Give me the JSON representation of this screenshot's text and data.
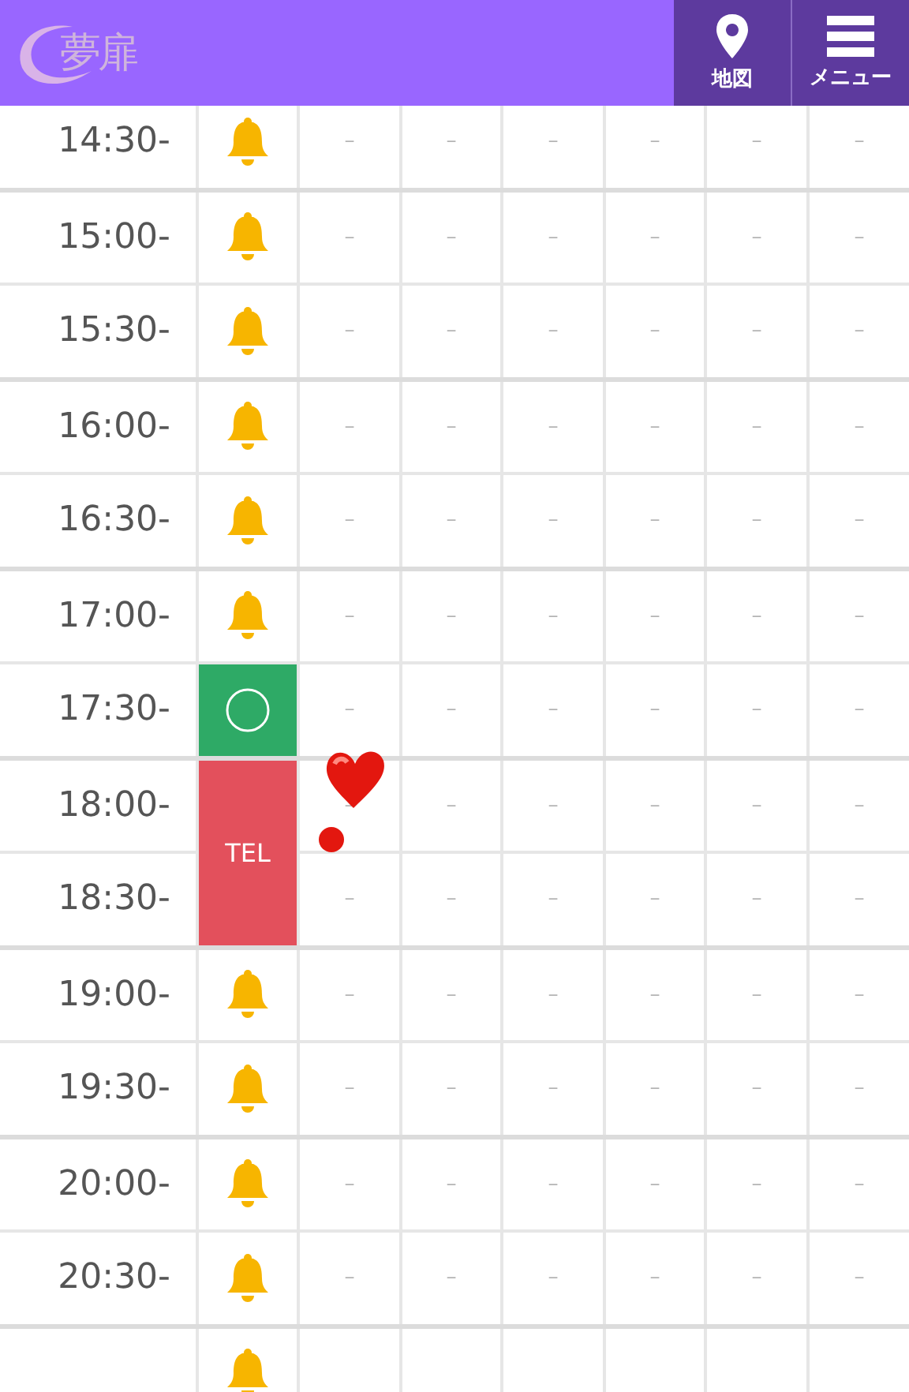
{
  "header": {
    "logo": "夢扉",
    "buttons": [
      {
        "kind": "map",
        "label": "地図"
      },
      {
        "kind": "menu",
        "label": "メニュー"
      }
    ]
  },
  "rows": [
    {
      "time": "14:30-",
      "status": {
        "kind": "bell"
      },
      "cells": [
        "－",
        "－",
        "－",
        "－",
        "－",
        "－"
      ]
    },
    {
      "time": "15:00-",
      "status": {
        "kind": "bell"
      },
      "cells": [
        "－",
        "－",
        "－",
        "－",
        "－",
        "－"
      ]
    },
    {
      "time": "15:30-",
      "status": {
        "kind": "bell"
      },
      "cells": [
        "－",
        "－",
        "－",
        "－",
        "－",
        "－"
      ]
    },
    {
      "time": "16:00-",
      "status": {
        "kind": "bell"
      },
      "cells": [
        "－",
        "－",
        "－",
        "－",
        "－",
        "－"
      ]
    },
    {
      "time": "16:30-",
      "status": {
        "kind": "bell"
      },
      "cells": [
        "－",
        "－",
        "－",
        "－",
        "－",
        "－"
      ]
    },
    {
      "time": "17:00-",
      "status": {
        "kind": "bell"
      },
      "cells": [
        "－",
        "－",
        "－",
        "－",
        "－",
        "－"
      ]
    },
    {
      "time": "17:30-",
      "status": {
        "kind": "open"
      },
      "cells": [
        "－",
        "－",
        "－",
        "－",
        "－",
        "－"
      ]
    },
    {
      "time": "18:00-",
      "status": {
        "kind": "tel",
        "label": "TEL"
      },
      "cells": [
        "－",
        "－",
        "－",
        "－",
        "－",
        "－"
      ]
    },
    {
      "time": "18:30-",
      "status": {
        "kind": "continued"
      },
      "cells": [
        "－",
        "－",
        "－",
        "－",
        "－",
        "－"
      ]
    },
    {
      "time": "19:00-",
      "status": {
        "kind": "bell"
      },
      "cells": [
        "－",
        "－",
        "－",
        "－",
        "－",
        "－"
      ]
    },
    {
      "time": "19:30-",
      "status": {
        "kind": "bell"
      },
      "cells": [
        "－",
        "－",
        "－",
        "－",
        "－",
        "－"
      ]
    },
    {
      "time": "20:00-",
      "status": {
        "kind": "bell"
      },
      "cells": [
        "－",
        "－",
        "－",
        "－",
        "－",
        "－"
      ]
    },
    {
      "time": "20:30-",
      "status": {
        "kind": "bell"
      },
      "cells": [
        "－",
        "－",
        "－",
        "－",
        "－",
        "－"
      ]
    },
    {
      "status": {
        "kind": "bell"
      },
      "cells": []
    }
  ]
}
